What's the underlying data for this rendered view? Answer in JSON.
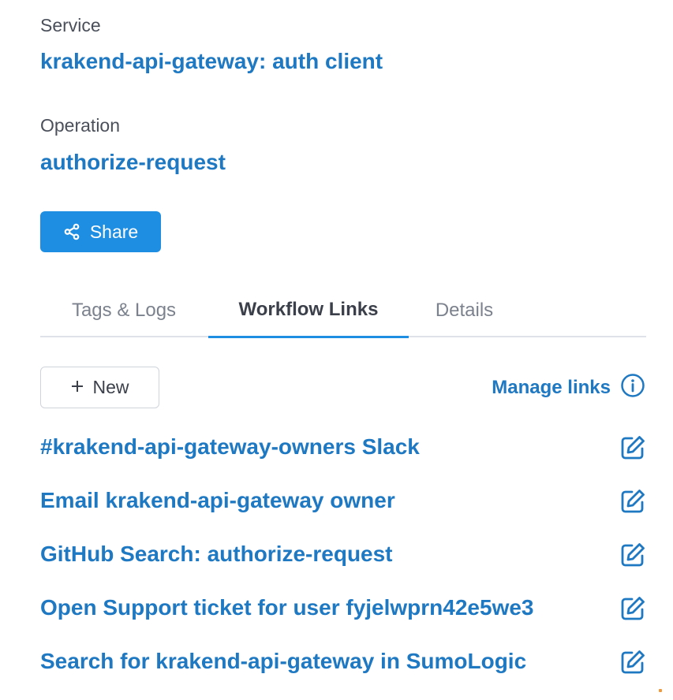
{
  "service": {
    "label": "Service",
    "value": "krakend-api-gateway: auth client"
  },
  "operation": {
    "label": "Operation",
    "value": "authorize-request"
  },
  "share_button": {
    "label": "Share",
    "icon": "share-icon"
  },
  "tabs": [
    {
      "label": "Tags & Logs",
      "active": false
    },
    {
      "label": "Workflow Links",
      "active": true
    },
    {
      "label": "Details",
      "active": false
    }
  ],
  "new_button": {
    "label": "New",
    "icon": "plus-icon"
  },
  "manage_links": {
    "label": "Manage links",
    "icon": "info-icon"
  },
  "links": [
    {
      "label": "#krakend-api-gateway-owners Slack",
      "icon": "edit-icon"
    },
    {
      "label": "Email krakend-api-gateway owner",
      "icon": "edit-icon"
    },
    {
      "label": "GitHub Search: authorize-request",
      "icon": "edit-icon"
    },
    {
      "label": "Open Support ticket for user fyjelwprn42e5we3",
      "icon": "edit-icon"
    },
    {
      "label": "Search for krakend-api-gateway in SumoLogic",
      "icon": "edit-icon"
    }
  ],
  "colors": {
    "link": "#1e78c2",
    "primary_button": "#1d8ee2",
    "label": "#4a4f5a"
  }
}
